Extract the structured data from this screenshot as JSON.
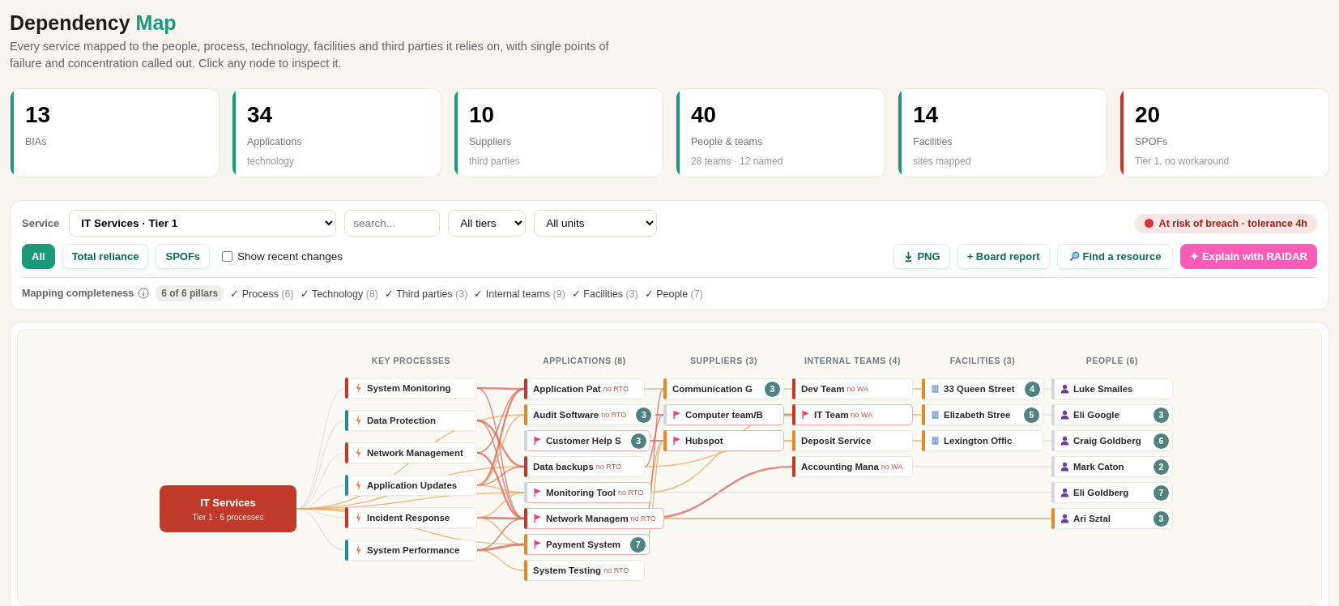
{
  "header": {
    "title": "Dependency",
    "title_accent": "Map",
    "description": "Every service mapped to the people, process, technology, facilities and third parties it relies on, with single points of failure and concentration called out. Click any node to inspect it."
  },
  "stats": [
    {
      "value": "13",
      "label": "BIAs",
      "color": "#1a9a7a"
    },
    {
      "value": "34",
      "label": "Applications",
      "sub": "technology",
      "color": "#1a9a7a"
    },
    {
      "value": "10",
      "label": "Suppliers",
      "sub": "third parties",
      "color": "#1a9a7a"
    },
    {
      "value": "40",
      "label": "People & teams",
      "sub": "28 teams · 12 named",
      "color": "#1a9a7a"
    },
    {
      "value": "14",
      "label": "Facilities",
      "sub": "sites mapped",
      "color": "#1a9a7a"
    },
    {
      "value": "20",
      "label": "SPOFs",
      "sub": "Tier 1, no workaround",
      "color": "#c0392b"
    }
  ],
  "controls": {
    "service_label": "Service",
    "service": "IT Services · Tier 1",
    "search_placeholder": "search...",
    "tier": "All tiers",
    "unit": "All units",
    "risk_badge": "At risk of breach · tolerance 4h",
    "filters": [
      {
        "label": "All",
        "selected": true
      },
      {
        "label": "Total reliance",
        "selected": false
      },
      {
        "label": "SPOFs",
        "selected": false
      }
    ],
    "recent_changes": {
      "label": "Show recent changes",
      "checked": false
    },
    "actions": [
      {
        "label": "PNG",
        "kind": "download"
      },
      {
        "label": "+ Board report",
        "kind": "plain"
      },
      {
        "label": "Find a resource",
        "kind": "search"
      },
      {
        "label": "✦ Explain with RAiDAR",
        "kind": "primary"
      }
    ]
  },
  "completeness": {
    "label": "Mapping completeness",
    "badge": "6 of 6 pillars",
    "pillars": [
      {
        "mark": "✓",
        "label": "Process",
        "count": "(6)"
      },
      {
        "mark": "✓",
        "label": "Technology",
        "count": "(8)"
      },
      {
        "mark": "✓",
        "label": "Third parties",
        "count": "(3)"
      },
      {
        "mark": "✓",
        "label": "Internal teams",
        "count": "(9)"
      },
      {
        "mark": "✓",
        "label": "Facilities",
        "count": "(3)"
      },
      {
        "mark": "✓",
        "label": "People",
        "count": "(7)"
      }
    ]
  },
  "map": {
    "root": {
      "label": "IT Services",
      "sub": "Tier 1 · 6 processes"
    },
    "columns": [
      {
        "header": "KEY PROCESSES",
        "kind": "process",
        "nodes": [
          {
            "label": "System Monitoring",
            "color": "#c0392b",
            "flagged": false
          },
          {
            "label": "Data Protection",
            "color": "#2a8a9a",
            "flagged": false
          },
          {
            "label": "Network Management",
            "color": "#c0392b",
            "flagged": false
          },
          {
            "label": "Application Updates",
            "color": "#2a8a9a",
            "flagged": false
          },
          {
            "label": "Incident Response",
            "color": "#c0392b",
            "flagged": false
          },
          {
            "label": "System Performance",
            "color": "#2a8a9a",
            "flagged": false
          }
        ]
      },
      {
        "header": "APPLICATIONS (8)",
        "kind": "application",
        "nodes": [
          {
            "label": "Application Pat",
            "note": "no RTO",
            "color": "#c0392b",
            "flagged": false
          },
          {
            "label": "Audit Software",
            "note": "no RTO",
            "count": "3",
            "color": "#e08a2c",
            "flagged": false
          },
          {
            "label": "Customer Help S",
            "count": "3",
            "color": "#cfd6dc",
            "flagged": true
          },
          {
            "label": "Data backups",
            "note": "no RTO",
            "color": "#c0392b",
            "flagged": false
          },
          {
            "label": "Monitoring Tool",
            "note": "no RTO",
            "color": "#cfd6dc",
            "flagged": true
          },
          {
            "label": "Network Managem",
            "note": "no RTO",
            "color": "#c0392b",
            "flagged": true
          },
          {
            "label": "Payment System",
            "count": "7",
            "color": "#e08a2c",
            "flagged": true
          },
          {
            "label": "System Testing",
            "note": "no RTO",
            "color": "#e08a2c",
            "flagged": false
          }
        ]
      },
      {
        "header": "SUPPLIERS (3)",
        "kind": "supplier",
        "nodes": [
          {
            "label": "Communication G",
            "count": "3",
            "color": "#e08a2c",
            "flagged": false
          },
          {
            "label": "Computer team/B",
            "color": "#cfd6dc",
            "flagged": true
          },
          {
            "label": "Hubspot",
            "color": "#e08a2c",
            "flagged": true
          }
        ]
      },
      {
        "header": "INTERNAL TEAMS (4)",
        "kind": "team",
        "nodes": [
          {
            "label": "Dev Team",
            "note": "no WA",
            "color": "#c0392b",
            "flagged": false
          },
          {
            "label": "IT Team",
            "note": "no WA",
            "color": "#c0392b",
            "flagged": true
          },
          {
            "label": "Deposit Service",
            "color": "#e08a2c",
            "flagged": false
          },
          {
            "label": "Accounting Mana",
            "note": "no WA",
            "color": "#c0392b",
            "flagged": false
          }
        ]
      },
      {
        "header": "FACILITIES (3)",
        "kind": "facility",
        "nodes": [
          {
            "label": "33 Queen Street",
            "count": "4",
            "color": "#e08a2c",
            "flagged": false
          },
          {
            "label": "Elizabeth Stree",
            "count": "5",
            "color": "#e08a2c",
            "flagged": false
          },
          {
            "label": "Lexington Offic",
            "color": "#e08a2c",
            "flagged": false
          }
        ]
      },
      {
        "header": "PEOPLE (6)",
        "kind": "person",
        "nodes": [
          {
            "label": "Luke Smailes",
            "color": "#cfd6dc",
            "flagged": false
          },
          {
            "label": "Eli Google",
            "count": "3",
            "color": "#cfd6dc",
            "flagged": false
          },
          {
            "label": "Craig Goldberg",
            "count": "6",
            "color": "#cfd6dc",
            "flagged": false
          },
          {
            "label": "Mark Caton",
            "count": "2",
            "color": "#cfd6dc",
            "flagged": false
          },
          {
            "label": "Eli Goldberg",
            "count": "7",
            "color": "#cfd6dc",
            "flagged": false
          },
          {
            "label": "Ari Sztal",
            "count": "3",
            "color": "#e08a2c",
            "flagged": false
          }
        ]
      }
    ]
  }
}
